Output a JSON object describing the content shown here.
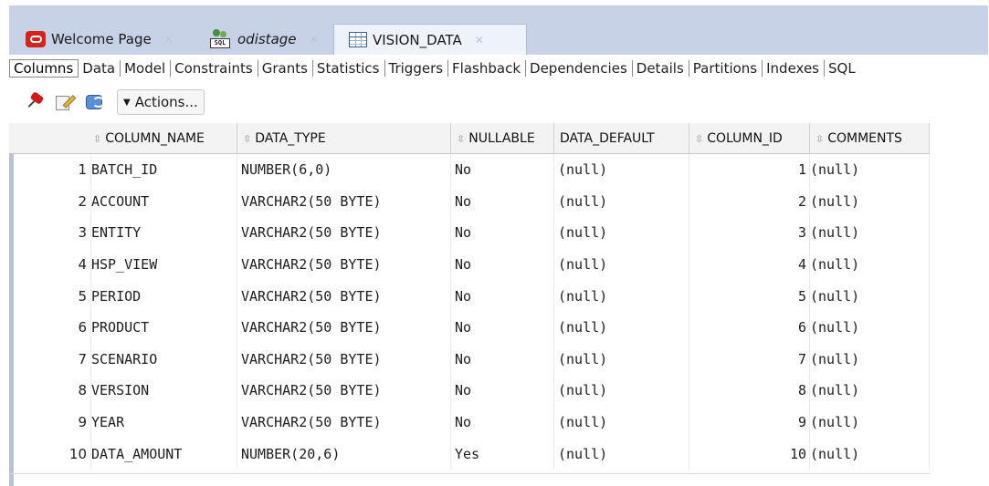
{
  "tabs": [
    {
      "label": "Welcome Page",
      "icon": "oracle-icon"
    },
    {
      "label": "odistage",
      "icon": "sql-connection-icon"
    },
    {
      "label": "VISION_DATA",
      "icon": "table-icon",
      "active": true
    }
  ],
  "subtabs": [
    "Columns",
    "Data",
    "Model",
    "Constraints",
    "Grants",
    "Statistics",
    "Triggers",
    "Flashback",
    "Dependencies",
    "Details",
    "Partitions",
    "Indexes",
    "SQL"
  ],
  "toolbar": {
    "actions_label": "Actions...",
    "icons": [
      "pin-icon",
      "edit-icon",
      "refresh-icon"
    ]
  },
  "grid": {
    "columns": [
      "COLUMN_NAME",
      "DATA_TYPE",
      "NULLABLE",
      "DATA_DEFAULT",
      "COLUMN_ID",
      "COMMENTS"
    ],
    "rows": [
      {
        "n": "1",
        "name": "BATCH_ID",
        "type": "NUMBER(6,0)",
        "nullable": "No",
        "default": "(null)",
        "id": "1",
        "comments": "(null)"
      },
      {
        "n": "2",
        "name": "ACCOUNT",
        "type": "VARCHAR2(50 BYTE)",
        "nullable": "No",
        "default": "(null)",
        "id": "2",
        "comments": "(null)"
      },
      {
        "n": "3",
        "name": "ENTITY",
        "type": "VARCHAR2(50 BYTE)",
        "nullable": "No",
        "default": "(null)",
        "id": "3",
        "comments": "(null)"
      },
      {
        "n": "4",
        "name": "HSP_VIEW",
        "type": "VARCHAR2(50 BYTE)",
        "nullable": "No",
        "default": "(null)",
        "id": "4",
        "comments": "(null)"
      },
      {
        "n": "5",
        "name": "PERIOD",
        "type": "VARCHAR2(50 BYTE)",
        "nullable": "No",
        "default": "(null)",
        "id": "5",
        "comments": "(null)"
      },
      {
        "n": "6",
        "name": "PRODUCT",
        "type": "VARCHAR2(50 BYTE)",
        "nullable": "No",
        "default": "(null)",
        "id": "6",
        "comments": "(null)"
      },
      {
        "n": "7",
        "name": "SCENARIO",
        "type": "VARCHAR2(50 BYTE)",
        "nullable": "No",
        "default": "(null)",
        "id": "7",
        "comments": "(null)"
      },
      {
        "n": "8",
        "name": "VERSION",
        "type": "VARCHAR2(50 BYTE)",
        "nullable": "No",
        "default": "(null)",
        "id": "8",
        "comments": "(null)"
      },
      {
        "n": "9",
        "name": "YEAR",
        "type": "VARCHAR2(50 BYTE)",
        "nullable": "No",
        "default": "(null)",
        "id": "9",
        "comments": "(null)"
      },
      {
        "n": "10",
        "name": "DATA_AMOUNT",
        "type": "NUMBER(20,6)",
        "nullable": "Yes",
        "default": "(null)",
        "id": "10",
        "comments": "(null)"
      }
    ]
  }
}
